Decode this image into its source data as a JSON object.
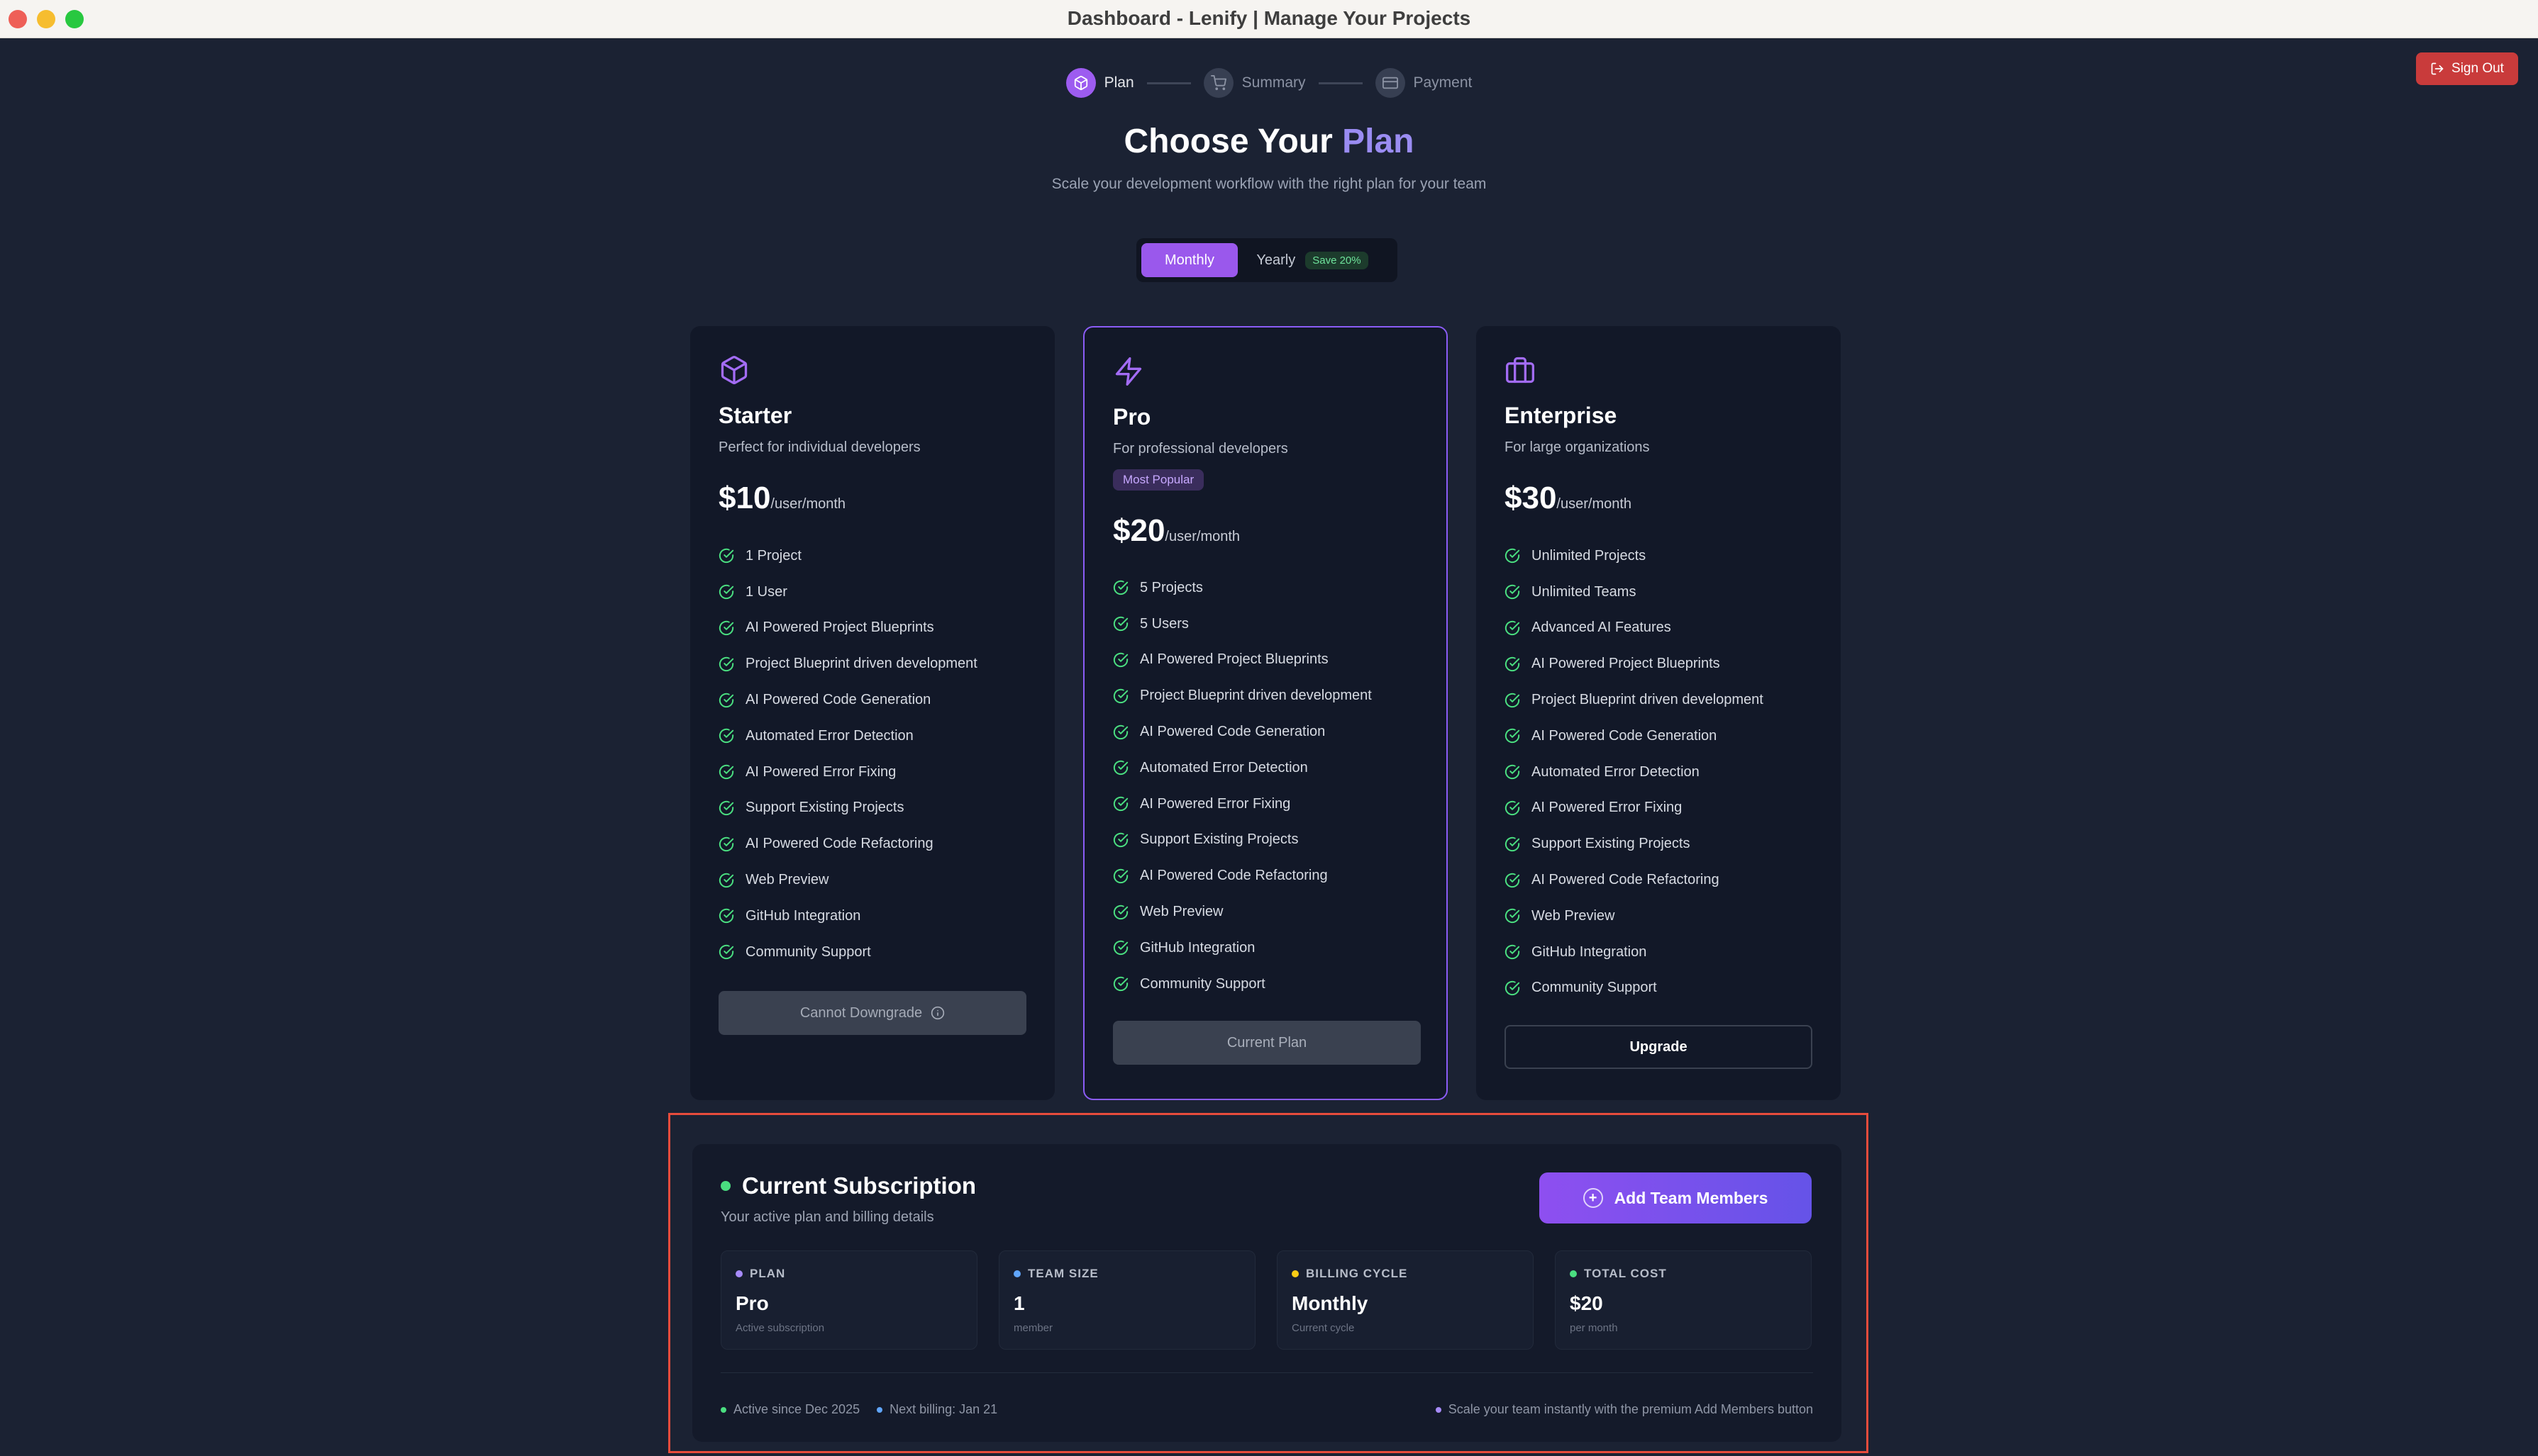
{
  "window": {
    "title": "Dashboard - Lenify | Manage Your Projects"
  },
  "header": {
    "sign_out": "Sign Out"
  },
  "stepper": [
    {
      "label": "Plan",
      "icon": "package-icon",
      "active": true
    },
    {
      "label": "Summary",
      "icon": "cart-icon",
      "active": false
    },
    {
      "label": "Payment",
      "icon": "card-icon",
      "active": false
    }
  ],
  "hero": {
    "title_prefix": "Choose Your",
    "title_accent": "Plan",
    "subtitle": "Scale your development workflow with the right plan for your team"
  },
  "billing_toggle": {
    "monthly": "Monthly",
    "yearly": "Yearly",
    "save_badge": "Save 20%",
    "selected": "Monthly"
  },
  "plans": [
    {
      "name": "Starter",
      "icon": "package-icon",
      "description": "Perfect for individual developers",
      "price": "$10",
      "unit": "/user/month",
      "features": [
        "1 Project",
        "1 User",
        "AI Powered Project Blueprints",
        "Project Blueprint driven development",
        "AI Powered Code Generation",
        "Automated Error Detection",
        "AI Powered Error Fixing",
        "Support Existing Projects",
        "AI Powered Code Refactoring",
        "Web Preview",
        "GitHub Integration",
        "Community Support"
      ],
      "button": "Cannot Downgrade"
    },
    {
      "name": "Pro",
      "icon": "zap-icon",
      "description": "For professional developers",
      "badge": "Most Popular",
      "price": "$20",
      "unit": "/user/month",
      "features": [
        "5 Projects",
        "5 Users",
        "AI Powered Project Blueprints",
        "Project Blueprint driven development",
        "AI Powered Code Generation",
        "Automated Error Detection",
        "AI Powered Error Fixing",
        "Support Existing Projects",
        "AI Powered Code Refactoring",
        "Web Preview",
        "GitHub Integration",
        "Community Support"
      ],
      "button": "Current Plan"
    },
    {
      "name": "Enterprise",
      "icon": "briefcase-icon",
      "description": "For large organizations",
      "price": "$30",
      "unit": "/user/month",
      "features": [
        "Unlimited Projects",
        "Unlimited Teams",
        "Advanced AI Features",
        "AI Powered Project Blueprints",
        "Project Blueprint driven development",
        "AI Powered Code Generation",
        "Automated Error Detection",
        "AI Powered Error Fixing",
        "Support Existing Projects",
        "AI Powered Code Refactoring",
        "Web Preview",
        "GitHub Integration",
        "Community Support"
      ],
      "button": "Upgrade"
    }
  ],
  "subscription": {
    "title": "Current Subscription",
    "description": "Your active plan and billing details",
    "add_button": "Add Team Members",
    "stats": [
      {
        "label": "PLAN",
        "value": "Pro",
        "sub": "Active subscription",
        "color": "#a78bfa"
      },
      {
        "label": "TEAM SIZE",
        "value": "1",
        "sub": "member",
        "color": "#60a5fa"
      },
      {
        "label": "BILLING CYCLE",
        "value": "Monthly",
        "sub": "Current cycle",
        "color": "#facc15"
      },
      {
        "label": "TOTAL COST",
        "value": "$20",
        "sub": "per month",
        "color": "#4ade80"
      }
    ],
    "active_since": "Active since Dec 2025",
    "next_billing": "Next billing: Jan 21",
    "hint": "Scale your team instantly with the premium Add Members button"
  },
  "colors": {
    "accent": "#9a58ec",
    "check": "#4ade80",
    "danger": "#c93b3b",
    "background": "#1b2233"
  }
}
